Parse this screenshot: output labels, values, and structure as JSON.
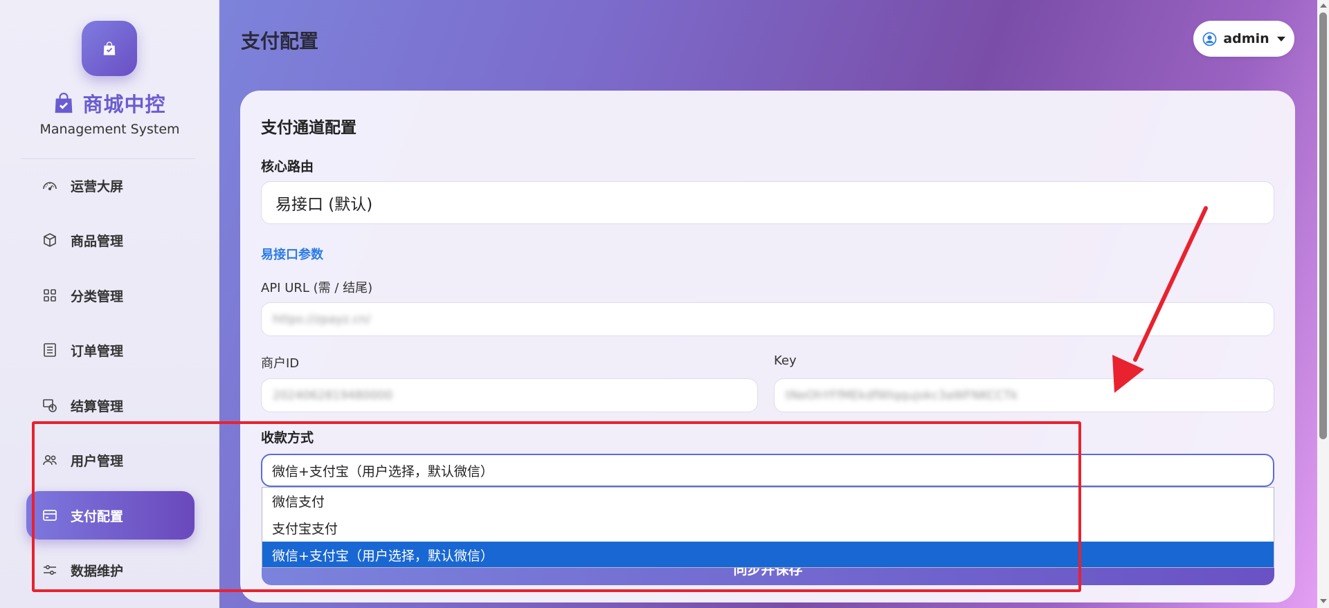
{
  "sidebar": {
    "brand_name": "商城中控",
    "brand_sub": "Management System",
    "items": [
      {
        "label": "运营大屏",
        "icon": "speedometer-icon"
      },
      {
        "label": "商品管理",
        "icon": "box-icon"
      },
      {
        "label": "分类管理",
        "icon": "grid-icon"
      },
      {
        "label": "订单管理",
        "icon": "list-icon"
      },
      {
        "label": "结算管理",
        "icon": "cash-icon"
      },
      {
        "label": "用户管理",
        "icon": "people-icon"
      },
      {
        "label": "支付配置",
        "icon": "credit-card-icon",
        "active": true
      },
      {
        "label": "数据维护",
        "icon": "sliders-icon"
      }
    ]
  },
  "header": {
    "title": "支付配置",
    "user_label": "admin"
  },
  "card": {
    "title": "支付通道配置",
    "core_route_label": "核心路由",
    "core_route_value": "易接口 (默认)",
    "section_label": "易接口参数",
    "api_url_label": "API URL (需 / 结尾)",
    "api_url_value": "https://zpayz.cn/",
    "merchant_id_label": "商户ID",
    "merchant_id_value": "2024062819480000",
    "key_label": "Key",
    "key_value": "tNeOhYFfMEkdfWIqqujokc3aWFNKCCTk",
    "payment_method_label": "收款方式",
    "payment_method_value": "微信+支付宝（用户选择，默认微信）",
    "payment_options": [
      "微信支付",
      "支付宝支付",
      "微信+支付宝（用户选择，默认微信）"
    ],
    "save_button_label": "同步并保存"
  },
  "colors": {
    "accent": "#6a5cd0",
    "active_nav": "#6a48bc",
    "link": "#2c7be5",
    "selected_option": "#1967d2",
    "highlight": "#e8222e"
  }
}
